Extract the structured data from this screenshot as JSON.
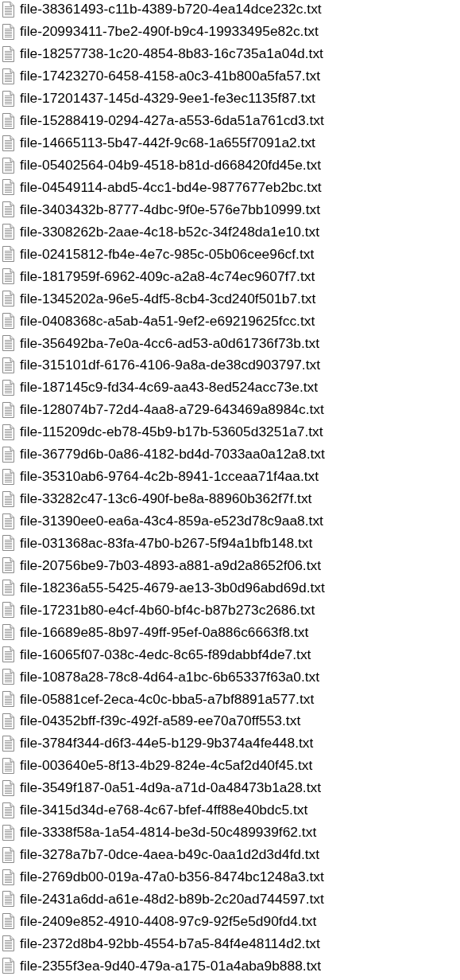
{
  "files": [
    {
      "name": "file-38361493-c11b-4389-b720-4ea14dce232c.txt"
    },
    {
      "name": "file-20993411-7be2-490f-b9c4-19933495e82c.txt"
    },
    {
      "name": "file-18257738-1c20-4854-8b83-16c735a1a04d.txt"
    },
    {
      "name": "file-17423270-6458-4158-a0c3-41b800a5fa57.txt"
    },
    {
      "name": "file-17201437-145d-4329-9ee1-fe3ec1135f87.txt"
    },
    {
      "name": "file-15288419-0294-427a-a553-6da51a761cd3.txt"
    },
    {
      "name": "file-14665113-5b47-442f-9c68-1a655f7091a2.txt"
    },
    {
      "name": "file-05402564-04b9-4518-b81d-d668420fd45e.txt"
    },
    {
      "name": "file-04549114-abd5-4cc1-bd4e-9877677eb2bc.txt"
    },
    {
      "name": "file-3403432b-8777-4dbc-9f0e-576e7bb10999.txt"
    },
    {
      "name": "file-3308262b-2aae-4c18-b52c-34f248da1e10.txt"
    },
    {
      "name": "file-02415812-fb4e-4e7c-985c-05b06cee96cf.txt"
    },
    {
      "name": "file-1817959f-6962-409c-a2a8-4c74ec9607f7.txt"
    },
    {
      "name": "file-1345202a-96e5-4df5-8cb4-3cd240f501b7.txt"
    },
    {
      "name": "file-0408368c-a5ab-4a51-9ef2-e69219625fcc.txt"
    },
    {
      "name": "file-356492ba-7e0a-4cc6-ad53-a0d61736f73b.txt"
    },
    {
      "name": "file-315101df-6176-4106-9a8a-de38cd903797.txt"
    },
    {
      "name": "file-187145c9-fd34-4c69-aa43-8ed524acc73e.txt"
    },
    {
      "name": "file-128074b7-72d4-4aa8-a729-643469a8984c.txt"
    },
    {
      "name": "file-115209dc-eb78-45b9-b17b-53605d3251a7.txt"
    },
    {
      "name": "file-36779d6b-0a86-4182-bd4d-7033aa0a12a8.txt"
    },
    {
      "name": "file-35310ab6-9764-4c2b-8941-1cceaa71f4aa.txt"
    },
    {
      "name": "file-33282c47-13c6-490f-be8a-88960b362f7f.txt"
    },
    {
      "name": "file-31390ee0-ea6a-43c4-859a-e523d78c9aa8.txt"
    },
    {
      "name": "file-031368ac-83fa-47b0-b267-5f94a1bfb148.txt"
    },
    {
      "name": "file-20756be9-7b03-4893-a881-a9d2a8652f06.txt"
    },
    {
      "name": "file-18236a55-5425-4679-ae13-3b0d96abd69d.txt"
    },
    {
      "name": "file-17231b80-e4cf-4b60-bf4c-b87b273c2686.txt"
    },
    {
      "name": "file-16689e85-8b97-49ff-95ef-0a886c6663f8.txt"
    },
    {
      "name": "file-16065f07-038c-4edc-8c65-f89dabbf4de7.txt"
    },
    {
      "name": "file-10878a28-78c8-4d64-a1bc-6b65337f63a0.txt"
    },
    {
      "name": "file-05881cef-2eca-4c0c-bba5-a7bf8891a577.txt"
    },
    {
      "name": "file-04352bff-f39c-492f-a589-ee70a70ff553.txt"
    },
    {
      "name": "file-3784f344-d6f3-44e5-b129-9b374a4fe448.txt"
    },
    {
      "name": "file-003640e5-8f13-4b29-824e-4c5af2d40f45.txt"
    },
    {
      "name": "file-3549f187-0a51-4d9a-a71d-0a48473b1a28.txt"
    },
    {
      "name": "file-3415d34d-e768-4c67-bfef-4ff88e40bdc5.txt"
    },
    {
      "name": "file-3338f58a-1a54-4814-be3d-50c489939f62.txt"
    },
    {
      "name": "file-3278a7b7-0dce-4aea-b49c-0aa1d2d3d4fd.txt"
    },
    {
      "name": "file-2769db00-019a-47a0-b356-8474bc1248a3.txt"
    },
    {
      "name": "file-2431a6dd-a61e-48d2-b89b-2c20ad744597.txt"
    },
    {
      "name": "file-2409e852-4910-4408-97c9-92f5e5d90fd4.txt"
    },
    {
      "name": "file-2372d8b4-92bb-4554-b7a5-84f4e48114d2.txt"
    },
    {
      "name": "file-2355f3ea-9d40-479a-a175-01a4aba9b888.txt"
    }
  ]
}
